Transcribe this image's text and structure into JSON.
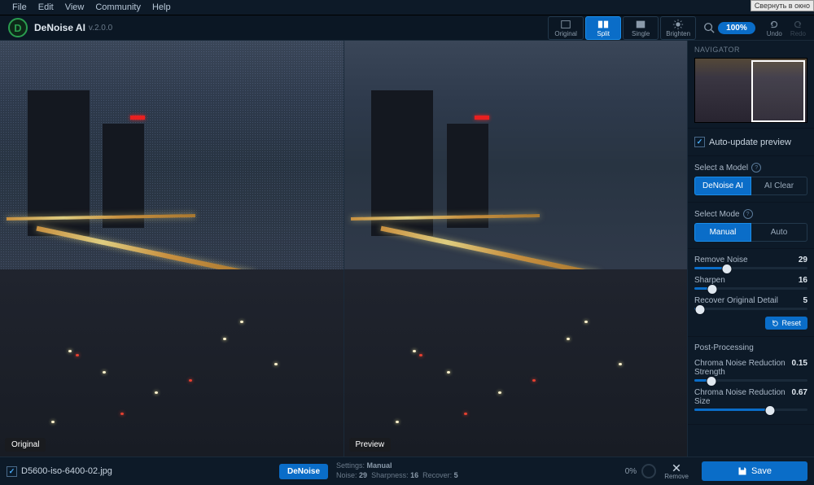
{
  "ext_button": "Свернуть в окно",
  "menu": {
    "file": "File",
    "edit": "Edit",
    "view": "View",
    "community": "Community",
    "help": "Help"
  },
  "app": {
    "name": "DeNoise AI",
    "version": "v.2.0.0"
  },
  "viewmodes": {
    "original": "Original",
    "split": "Split",
    "single": "Single",
    "brighten": "Brighten"
  },
  "zoom": {
    "percent": "100%"
  },
  "undoredo": {
    "undo": "Undo",
    "redo": "Redo"
  },
  "viewer": {
    "left_label": "Original",
    "right_label": "Preview"
  },
  "navigator": {
    "title": "NAVIGATOR"
  },
  "auto_update": {
    "label": "Auto-update preview",
    "checked": true
  },
  "model": {
    "label": "Select a Model",
    "opt1": "DeNoise AI",
    "opt2": "AI Clear"
  },
  "mode": {
    "label": "Select Mode",
    "opt1": "Manual",
    "opt2": "Auto"
  },
  "sliders": {
    "remove_noise": {
      "label": "Remove Noise",
      "value": 29,
      "pct": 29
    },
    "sharpen": {
      "label": "Sharpen",
      "value": 16,
      "pct": 16
    },
    "recover": {
      "label": "Recover Original Detail",
      "value": 5,
      "pct": 5
    }
  },
  "reset": "Reset",
  "post": {
    "title": "Post-Processing",
    "cnr_strength": {
      "label": "Chroma Noise Reduction Strength",
      "value": 0.15,
      "pct": 15
    },
    "cnr_size": {
      "label": "Chroma Noise Reduction Size",
      "value": 0.67,
      "pct": 67
    }
  },
  "footer": {
    "filename": "D5600-iso-6400-02.jpg",
    "process": "DeNoise",
    "settings_label": "Settings:",
    "settings_value": "Manual",
    "stats": {
      "noise_l": "Noise:",
      "noise_v": 29,
      "sharp_l": "Sharpness:",
      "sharp_v": 16,
      "rec_l": "Recover:",
      "rec_v": 5
    },
    "progress": "0%",
    "remove": "Remove",
    "save": "Save"
  }
}
